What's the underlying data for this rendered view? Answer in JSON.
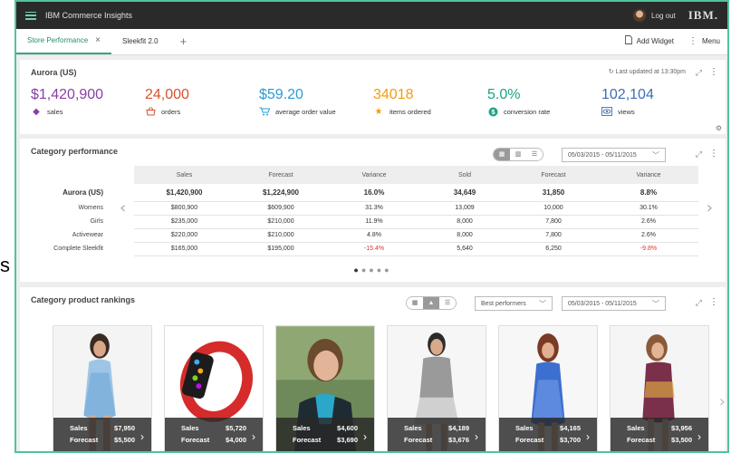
{
  "app": {
    "title": "IBM Commerce Insights",
    "logout": "Log out",
    "logo": "IBM."
  },
  "tabs": [
    {
      "label": "Store Performance",
      "close": "×",
      "active": true
    },
    {
      "label": "Sleekfit 2.0",
      "active": false
    }
  ],
  "tab_add": "+",
  "toolbar": {
    "add_widget": "Add Widget",
    "menu": "Menu"
  },
  "store": {
    "title": "Aurora (US)",
    "updated": "Last updated at 13:30pm",
    "metrics": [
      {
        "value": "$1,420,900",
        "label": "sales",
        "color": "#8a3ea6",
        "icon": "tag-icon"
      },
      {
        "value": "24,000",
        "label": "orders",
        "color": "#d9512c",
        "icon": "basket-icon"
      },
      {
        "value": "$59.20",
        "label": "average order value",
        "color": "#2a9bd6",
        "icon": "cart-icon"
      },
      {
        "value": "34018",
        "label": "items ordered",
        "color": "#f39c12",
        "icon": "star-icon"
      },
      {
        "value": "5.0%",
        "label": "conversion rate",
        "color": "#1aa384",
        "icon": "dollar-icon"
      },
      {
        "value": "102,104",
        "label": "views",
        "color": "#3b6fb6",
        "icon": "eye-icon"
      }
    ]
  },
  "category": {
    "title": "Category performance",
    "date_range": "05/03/2015 - 05/11/2015",
    "columns": [
      "Sales",
      "Forecast",
      "Variance",
      "Sold",
      "Forecast",
      "Variance"
    ],
    "rows": [
      {
        "name": "Aurora (US)",
        "cells": [
          "$1,420,900",
          "$1,224,900",
          "16.0%",
          "34,649",
          "31,850",
          "8.8%"
        ]
      },
      {
        "name": "Womens",
        "cells": [
          "$800,900",
          "$609,900",
          "31.3%",
          "13,009",
          "10,000",
          "30.1%"
        ]
      },
      {
        "name": "Girls",
        "cells": [
          "$235,000",
          "$210,000",
          "11.9%",
          "8,000",
          "7,800",
          "2.6%"
        ]
      },
      {
        "name": "Activewear",
        "cells": [
          "$220,000",
          "$210,000",
          "4.8%",
          "8,000",
          "7,800",
          "2.6%"
        ]
      },
      {
        "name": "Complete Sleekfit",
        "cells": [
          "$165,000",
          "$195,000",
          "-15.4%",
          "5,640",
          "6,250",
          "-9.8%"
        ]
      }
    ]
  },
  "rankings": {
    "title": "Category product rankings",
    "filter": "Best performers",
    "date_range": "05/03/2015 - 05/11/2015",
    "sales_label": "Sales",
    "forecast_label": "Forecast",
    "products": [
      {
        "sales": "$7,950",
        "forecast": "$5,500"
      },
      {
        "sales": "$5,720",
        "forecast": "$4,000"
      },
      {
        "sales": "$4,600",
        "forecast": "$3,690"
      },
      {
        "sales": "$4,189",
        "forecast": "$3,676"
      },
      {
        "sales": "$4,165",
        "forecast": "$3,700"
      },
      {
        "sales": "$3,956",
        "forecast": "$3,500"
      }
    ]
  },
  "outside_letter": "s"
}
